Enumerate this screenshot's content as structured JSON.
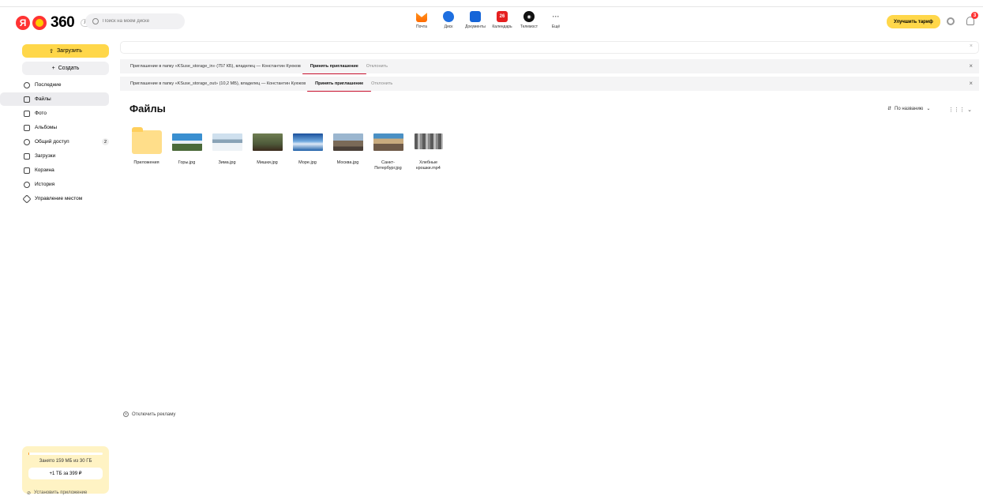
{
  "header": {
    "logo_text": "360",
    "logo_badge": "Лайт",
    "search_placeholder": "Поиск на моём диске",
    "services": [
      {
        "label": "Почта",
        "icon": "mail-icon"
      },
      {
        "label": "Диск",
        "icon": "disk-icon"
      },
      {
        "label": "Документы",
        "icon": "documents-icon"
      },
      {
        "label": "Календарь",
        "icon": "calendar-icon",
        "icon_text": "26"
      },
      {
        "label": "Телемост",
        "icon": "telemost-icon"
      },
      {
        "label": "Ещё",
        "icon": "more-icon"
      }
    ],
    "upgrade_label": "Улучшить тариф",
    "notifications_count": "3",
    "accent_color": "#ffd74a"
  },
  "sidebar": {
    "upload_label": "Загрузить",
    "create_label": "Создать",
    "items": [
      {
        "label": "Последние",
        "icon": "clock-icon"
      },
      {
        "label": "Файлы",
        "icon": "folder-icon",
        "active": true
      },
      {
        "label": "Фото",
        "icon": "photo-icon"
      },
      {
        "label": "Альбомы",
        "icon": "albums-icon"
      },
      {
        "label": "Общий доступ",
        "icon": "shared-icon",
        "count": "2"
      },
      {
        "label": "Загрузки",
        "icon": "downloads-icon"
      },
      {
        "label": "Корзина",
        "icon": "trash-icon"
      },
      {
        "label": "История",
        "icon": "history-icon"
      },
      {
        "label": "Управление местом",
        "icon": "storage-icon"
      }
    ],
    "storage": {
      "used_text": "Занято 159 МБ из 30 ГБ",
      "used_fraction": 0.005,
      "plus_label": "+1 ТБ за 399 ₽"
    },
    "install_label": "Установить приложение"
  },
  "invitations": [
    {
      "text": "Приглашение в папку «KSuse_storage_in» (757 КБ), владелец — Константин Куюков",
      "accept": "Принять приглашение",
      "decline": "Отклонить"
    },
    {
      "text": "Приглашение в папку «KSuse_storage_out» (10,2 МБ), владелец — Константин Куюков",
      "accept": "Принять приглашение",
      "decline": "Отклонить"
    }
  ],
  "main": {
    "title": "Файлы",
    "sort_label": "По названию",
    "files": [
      {
        "name": "Приложения",
        "type": "folder"
      },
      {
        "name": "Горы.jpg",
        "type": "image"
      },
      {
        "name": "Зима.jpg",
        "type": "image"
      },
      {
        "name": "Мишки.jpg",
        "type": "image"
      },
      {
        "name": "Море.jpg",
        "type": "image"
      },
      {
        "name": "Москва.jpg",
        "type": "image"
      },
      {
        "name": "Санкт-Петербург.jpg",
        "type": "image"
      },
      {
        "name": "Хлебные крошки.mp4",
        "type": "video"
      }
    ],
    "ads_label": "Отключить рекламу"
  }
}
